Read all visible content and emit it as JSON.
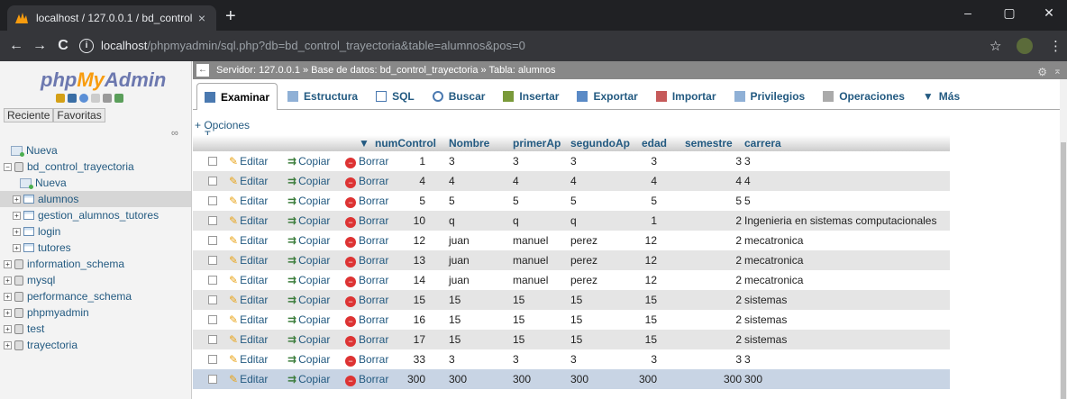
{
  "browser": {
    "tab_title": "localhost / 127.0.0.1 / bd_control",
    "tab_close": "×",
    "new_tab": "+",
    "url_host": "localhost",
    "url_path": "/phpmyadmin/sql.php?db=bd_control_trayectoria&table=alumnos&pos=0",
    "back": "←",
    "forward": "→",
    "reload": "C",
    "info": "i",
    "minimize": "–",
    "restore": "▢",
    "close": "✕",
    "star": "☆",
    "menu": "⋮"
  },
  "sidebar": {
    "logo_php": "php",
    "logo_my": "My",
    "logo_admin": "Admin",
    "recent": "Reciente",
    "favorites": "Favoritas",
    "link": "∞",
    "tree": [
      {
        "label": "Nueva",
        "level": 0,
        "type": "new"
      },
      {
        "label": "bd_control_trayectoria",
        "level": 0,
        "type": "db",
        "expanded": true
      },
      {
        "label": "Nueva",
        "level": 1,
        "type": "new"
      },
      {
        "label": "alumnos",
        "level": 1,
        "type": "table",
        "selected": true
      },
      {
        "label": "gestion_alumnos_tutores",
        "level": 1,
        "type": "table"
      },
      {
        "label": "login",
        "level": 1,
        "type": "table"
      },
      {
        "label": "tutores",
        "level": 1,
        "type": "table"
      },
      {
        "label": "information_schema",
        "level": 0,
        "type": "db"
      },
      {
        "label": "mysql",
        "level": 0,
        "type": "db"
      },
      {
        "label": "performance_schema",
        "level": 0,
        "type": "db"
      },
      {
        "label": "phpmyadmin",
        "level": 0,
        "type": "db"
      },
      {
        "label": "test",
        "level": 0,
        "type": "db"
      },
      {
        "label": "trayectoria",
        "level": 0,
        "type": "db"
      }
    ]
  },
  "breadcrumb": {
    "text": "Servidor: 127.0.0.1 » Base de datos: bd_control_trayectoria » Tabla: alumnos",
    "back": "←",
    "settings": "⚙",
    "max": "⌅"
  },
  "tabs": [
    "Examinar",
    "Estructura",
    "SQL",
    "Buscar",
    "Insertar",
    "Exportar",
    "Importar",
    "Privilegios",
    "Operaciones",
    "Más"
  ],
  "options_label": "+ Opciones",
  "arrows": "←T→",
  "sort_arrow": "▼",
  "table": {
    "columns": [
      "numControl",
      "Nombre",
      "primerAp",
      "segundoAp",
      "edad",
      "semestre",
      "carrera"
    ],
    "actions": {
      "edit": "Editar",
      "copy": "Copiar",
      "delete": "Borrar"
    },
    "rows": [
      [
        "1",
        "3",
        "3",
        "3",
        "3",
        "3",
        "3"
      ],
      [
        "4",
        "4",
        "4",
        "4",
        "4",
        "4",
        "4"
      ],
      [
        "5",
        "5",
        "5",
        "5",
        "5",
        "5",
        "5"
      ],
      [
        "10",
        "q",
        "q",
        "q",
        "1",
        "2",
        "Ingenieria en sistemas computacionales"
      ],
      [
        "12",
        "juan",
        "manuel",
        "perez",
        "12",
        "2",
        "mecatronica"
      ],
      [
        "13",
        "juan",
        "manuel",
        "perez",
        "12",
        "2",
        "mecatronica"
      ],
      [
        "14",
        "juan",
        "manuel",
        "perez",
        "12",
        "2",
        "mecatronica"
      ],
      [
        "15",
        "15",
        "15",
        "15",
        "15",
        "2",
        "sistemas"
      ],
      [
        "16",
        "15",
        "15",
        "15",
        "15",
        "2",
        "sistemas"
      ],
      [
        "17",
        "15",
        "15",
        "15",
        "15",
        "2",
        "sistemas"
      ],
      [
        "33",
        "3",
        "3",
        "3",
        "3",
        "3",
        "3"
      ],
      [
        "300",
        "300",
        "300",
        "300",
        "300",
        "300",
        "300"
      ]
    ]
  },
  "colors": {
    "link": "#235a81",
    "row_alt": "#e5e5e5",
    "row_highlight": "#c8d4e4",
    "chrome_dark": "#202124"
  }
}
